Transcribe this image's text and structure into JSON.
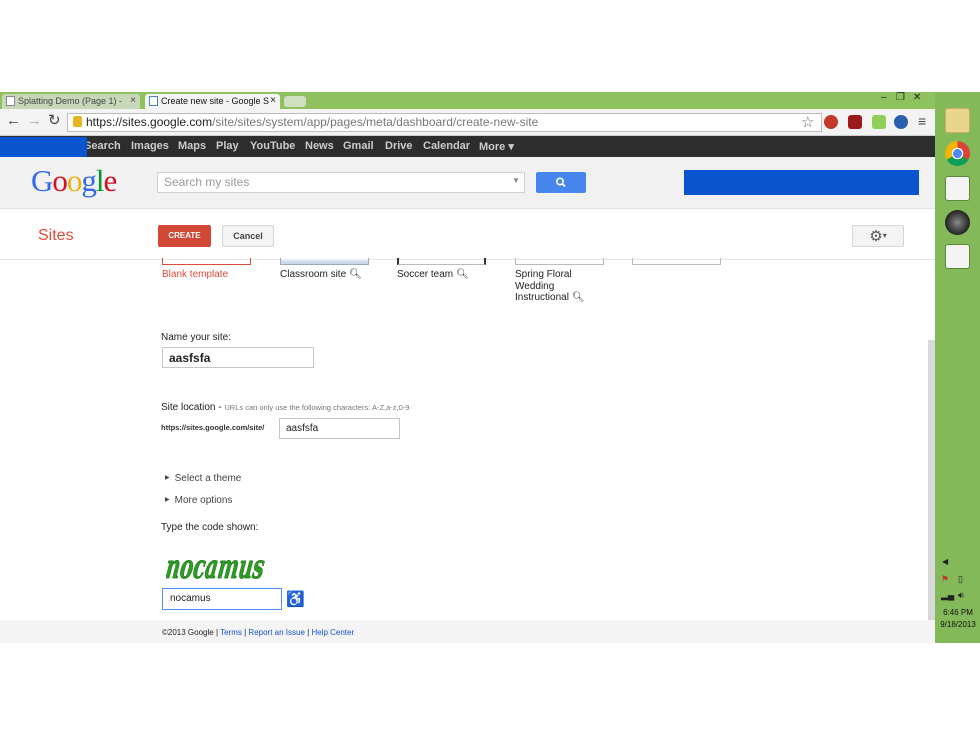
{
  "browser": {
    "tabs": [
      {
        "label": "Splatting Demo (Page 1) -",
        "close": "×"
      },
      {
        "label": "Create new site - Google S",
        "close": "×"
      }
    ],
    "url_host": "https://sites.google.com",
    "url_path": "/site/sites/system/app/pages/meta/dashboard/create-new-site",
    "window_controls": {
      "minimize": "–",
      "restore": "❐",
      "close": "✕"
    }
  },
  "google_bar": {
    "items": [
      "Search",
      "Images",
      "Maps",
      "Play",
      "YouTube",
      "News",
      "Gmail",
      "Drive",
      "Calendar",
      "More ▾"
    ]
  },
  "header": {
    "logo": "Google",
    "search_placeholder": "Search my sites"
  },
  "sites_bar": {
    "title": "Sites",
    "create_label": "CREATE",
    "cancel_label": "Cancel",
    "settings_caret": "▾"
  },
  "templates": [
    {
      "label": "Blank template"
    },
    {
      "label": "Classroom site"
    },
    {
      "label": "Soccer team"
    },
    {
      "label": "Spring Floral Wedding Instructional"
    }
  ],
  "form": {
    "name_label": "Name your site:",
    "name_value": "aasfsfa",
    "location_label": "Site location -",
    "location_hint": "URLs can only use the following characters: A-Z,a-z,0-9",
    "location_prefix": "https://sites.google.com/site/",
    "location_value": "aasfsfa",
    "select_theme": "Select a theme",
    "more_options": "More options",
    "captcha_label": "Type the code shown:",
    "captcha_text": "nocamus",
    "captcha_value": "nocamus"
  },
  "footer": {
    "copyright": "©2013 Google",
    "terms": "Terms",
    "report": "Report an Issue",
    "help": "Help Center"
  },
  "taskbar": {
    "time": "6:46 PM",
    "date": "9/18/2013"
  },
  "colors": {
    "accent_red": "#d14836",
    "link_blue": "#1155cc",
    "taskbar_green": "#84b95a",
    "redaction_blue": "#0a54d0"
  }
}
